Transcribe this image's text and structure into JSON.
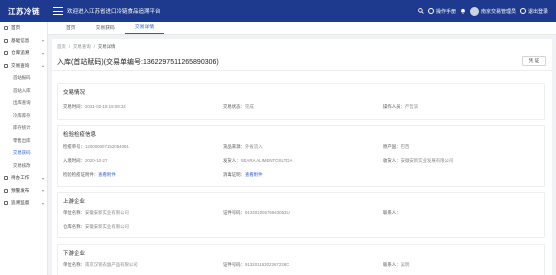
{
  "header": {
    "brand": "江苏冷链",
    "welcome": "欢迎进入江苏省进口冷链食品追溯平台",
    "manual": "操作手册",
    "user": "南京交易管理员",
    "logout": "退出登录"
  },
  "sidebar": {
    "items": [
      {
        "label": "首页",
        "arrow": ""
      },
      {
        "label": "基础信息",
        "arrow": "▾"
      },
      {
        "label": "仓库追溯",
        "arrow": "▾"
      },
      {
        "label": "交易查询",
        "arrow": "▴"
      }
    ],
    "subitems": [
      "首站报码",
      "首站入库",
      "出库查询",
      "冷库库存",
      "库存统计",
      "零售出库",
      "交易获码",
      "交易核改"
    ],
    "bottom": [
      {
        "label": "待办工作",
        "arrow": "▾"
      },
      {
        "label": "预警发布",
        "arrow": "▾"
      },
      {
        "label": "追溯监督",
        "arrow": "▾"
      }
    ]
  },
  "tabs": [
    {
      "label": "首页",
      "active": false
    },
    {
      "label": "交易获码",
      "active": false
    },
    {
      "label": "交易详情",
      "active": true
    }
  ],
  "breadcrumb": [
    "首页",
    "交易查询",
    "交易详情"
  ],
  "page_title": "入库(首站赋码)(交易单编号:1362297511265890306)",
  "voucher_button": "凭 证",
  "sections": {
    "trade": {
      "title": "交易情况",
      "time_label": "交易时间：",
      "time_value": "2021-02-18 15:08:34",
      "status_label": "交易状态：",
      "status_value": "完成",
      "operator_label": "操作人员：",
      "operator_value": "严哲滨"
    },
    "quarantine": {
      "title": "检验检疫信息",
      "no_label": "检疫单号：",
      "no_value": "120000007152054081",
      "source_label": "货品来源：",
      "source_value": "外省流入",
      "country_label": "原产国：",
      "country_value": "巴西",
      "date_label": "入境时间：",
      "date_value": "2020-10-27",
      "shipper_label": "发货人：",
      "shipper_value": "SEARA ALIMENTOSLTDA",
      "receiver_label": "收货人：",
      "receiver_value": "安徽安新实业发展有限公司",
      "cert_label": "检验检疫证附件：",
      "cert_link": "查看附件",
      "disinfect_label": "消毒证明：",
      "disinfect_link": "查看附件"
    },
    "upstream": {
      "title": "上游企业",
      "unit_label": "单位名称：",
      "unit_value": "安徽安新实业有限公司",
      "license_label": "证件号码：",
      "license_value": "91340100676943053U",
      "contact_label": "联系人：",
      "contact_value": "",
      "warehouse_label": "仓库名称：",
      "warehouse_value": "安徽安新实业有限公司"
    },
    "downstream": {
      "title": "下游企业",
      "unit_label": "单位名称：",
      "unit_value": "南京汉铭农副产品有限公司",
      "license_label": "证件号码：",
      "license_value": "91320115302367238C",
      "contact_label": "联系人：",
      "contact_value": "吴明"
    }
  }
}
